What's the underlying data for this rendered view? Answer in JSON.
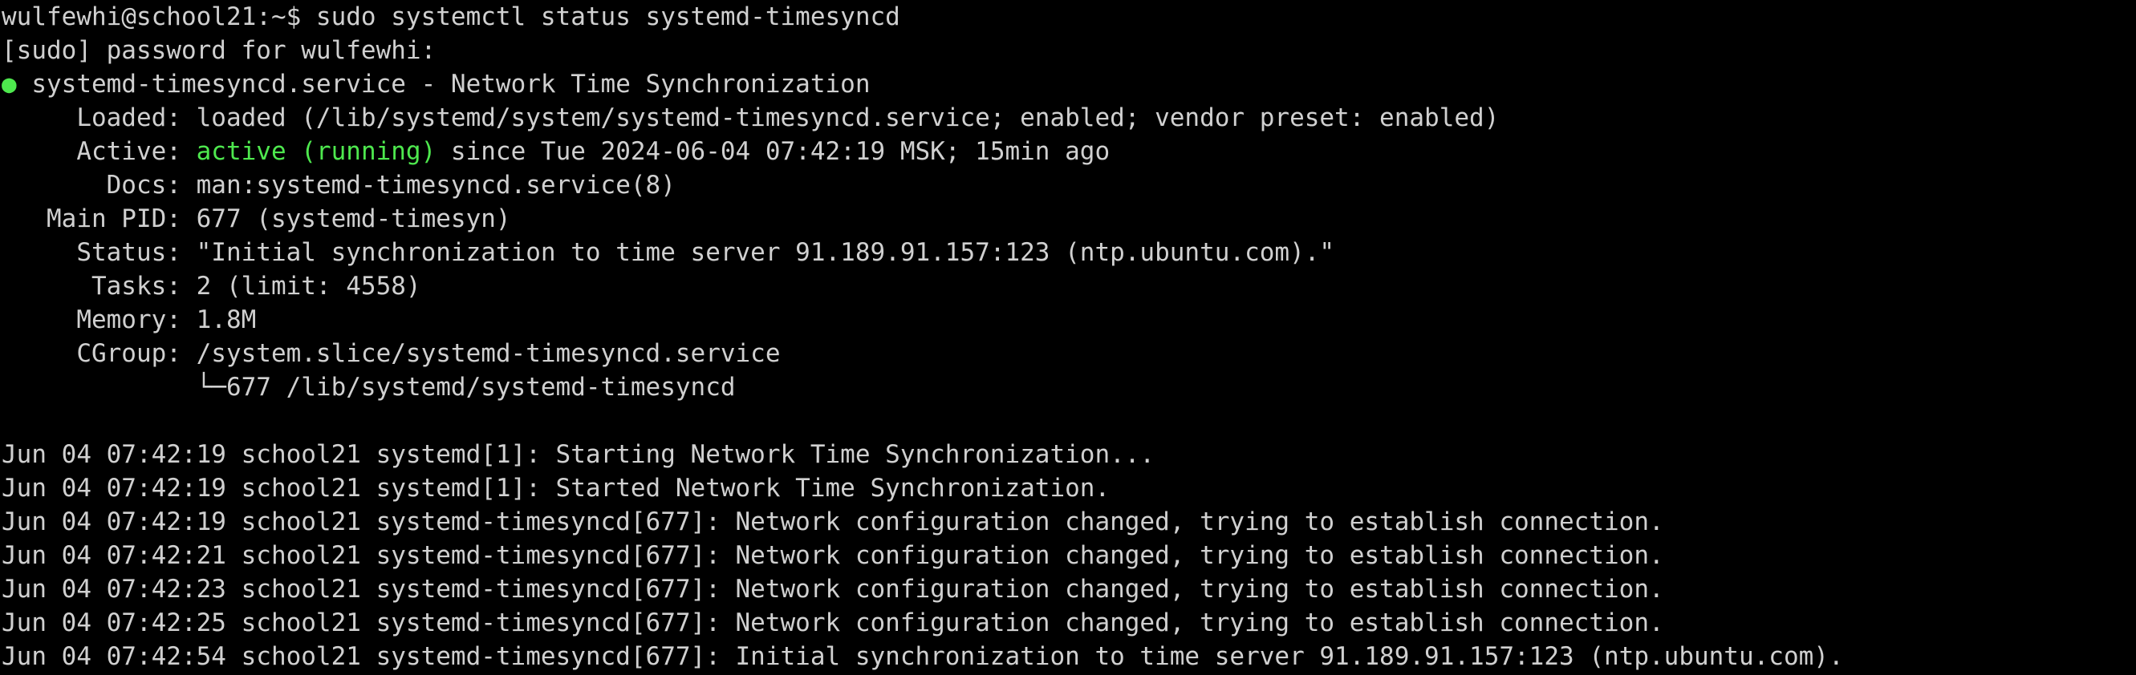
{
  "colors": {
    "background": "#000000",
    "foreground": "#d0d0d0",
    "active_green": "#4ee84e"
  },
  "terminal": {
    "prompt_line": "wulfewhi@school21:~$ sudo systemctl status systemd-timesyncd",
    "sudo_prompt": "[sudo] password for wulfewhi:",
    "status_dot": "●",
    "service_header": " systemd-timesyncd.service - Network Time Synchronization",
    "loaded_line": "     Loaded: loaded (/lib/systemd/system/systemd-timesyncd.service; enabled; vendor preset: enabled)",
    "active_label": "     Active: ",
    "active_state": "active (running)",
    "active_rest": " since Tue 2024-06-04 07:42:19 MSK; 15min ago",
    "docs_line": "       Docs: man:systemd-timesyncd.service(8)",
    "main_pid_line": "   Main PID: 677 (systemd-timesyn)",
    "status_line": "     Status: \"Initial synchronization to time server 91.189.91.157:123 (ntp.ubuntu.com).\"",
    "tasks_line": "      Tasks: 2 (limit: 4558)",
    "memory_line": "     Memory: 1.8M",
    "cgroup_line": "     CGroup: /system.slice/systemd-timesyncd.service",
    "cgroup_child_line": "             └─677 /lib/systemd/systemd-timesyncd",
    "log_lines": [
      "Jun 04 07:42:19 school21 systemd[1]: Starting Network Time Synchronization...",
      "Jun 04 07:42:19 school21 systemd[1]: Started Network Time Synchronization.",
      "Jun 04 07:42:19 school21 systemd-timesyncd[677]: Network configuration changed, trying to establish connection.",
      "Jun 04 07:42:21 school21 systemd-timesyncd[677]: Network configuration changed, trying to establish connection.",
      "Jun 04 07:42:23 school21 systemd-timesyncd[677]: Network configuration changed, trying to establish connection.",
      "Jun 04 07:42:25 school21 systemd-timesyncd[677]: Network configuration changed, trying to establish connection.",
      "Jun 04 07:42:54 school21 systemd-timesyncd[677]: Initial synchronization to time server 91.189.91.157:123 (ntp.ubuntu.com)."
    ]
  }
}
